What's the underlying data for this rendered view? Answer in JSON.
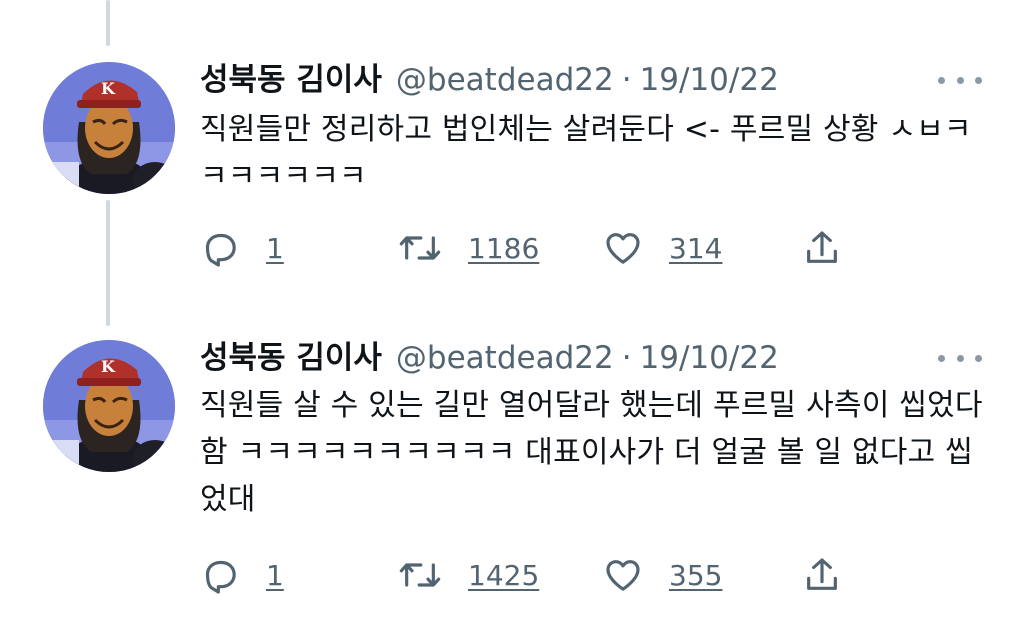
{
  "tweets": [
    {
      "author": {
        "display_name": "성북동 김이사",
        "handle": "@beatdead22",
        "separator": "·",
        "avatar_icon": "masked-figure-avatar"
      },
      "date": "19/10/22",
      "text": "직원들만 정리하고 법인체는 살려둔다 <- 푸르밀 상황 ㅅㅂㅋㅋㅋㅋㅋㅋㅋ",
      "replies": "1",
      "retweets": "1186",
      "likes": "314"
    },
    {
      "author": {
        "display_name": "성북동 김이사",
        "handle": "@beatdead22",
        "separator": "·",
        "avatar_icon": "masked-figure-avatar"
      },
      "date": "19/10/22",
      "text": "직원들 살 수 있는 길만 열어달라 했는데 푸르밀 사측이 씹었다함 ㅋㅋㅋㅋㅋㅋㅋㅋㅋㅋ 대표이사가 더 얼굴 볼 일 없다고 씹었대",
      "replies": "1",
      "retweets": "1425",
      "likes": "355"
    }
  ],
  "icons": {
    "more": "more-horizontal-icon",
    "reply": "reply-icon",
    "retweet": "retweet-icon",
    "like": "heart-icon",
    "share": "share-icon"
  },
  "colors": {
    "text_primary": "#0f1419",
    "text_secondary": "#536471",
    "thread_line": "#cfd9de",
    "avatar_bg": "#6f7dd8"
  }
}
